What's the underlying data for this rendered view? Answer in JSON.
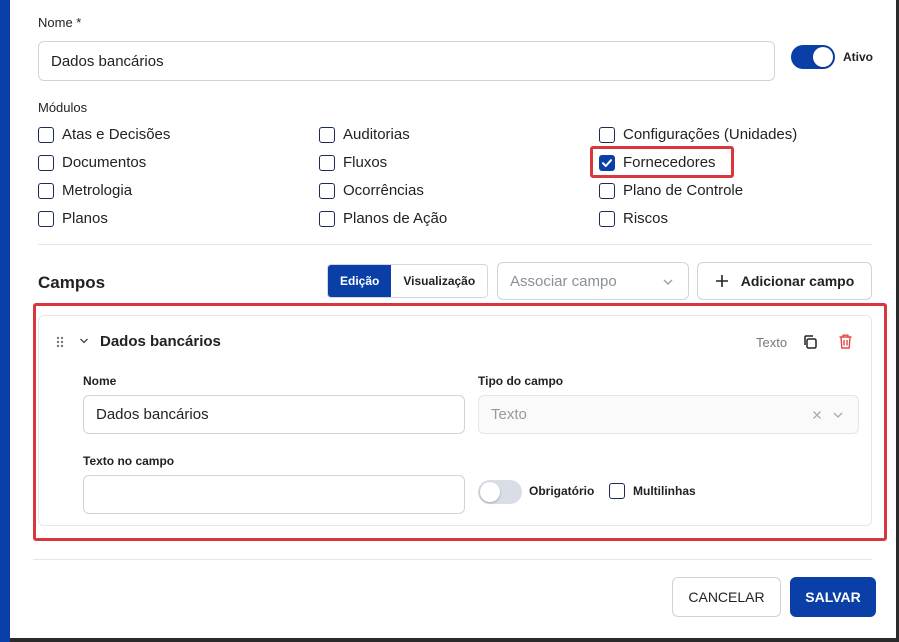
{
  "form": {
    "name_label": "Nome *",
    "name_value": "Dados bancários",
    "active_label": "Ativo",
    "active_on": true
  },
  "modules": {
    "label": "Módulos",
    "items": [
      {
        "label": "Atas e Decisões",
        "checked": false
      },
      {
        "label": "Auditorias",
        "checked": false
      },
      {
        "label": "Configurações (Unidades)",
        "checked": false
      },
      {
        "label": "Documentos",
        "checked": false
      },
      {
        "label": "Fluxos",
        "checked": false
      },
      {
        "label": "Fornecedores",
        "checked": true
      },
      {
        "label": "Metrologia",
        "checked": false
      },
      {
        "label": "Ocorrências",
        "checked": false
      },
      {
        "label": "Plano de Controle",
        "checked": false
      },
      {
        "label": "Planos",
        "checked": false
      },
      {
        "label": "Planos de Ação",
        "checked": false
      },
      {
        "label": "Riscos",
        "checked": false
      }
    ]
  },
  "fields": {
    "title": "Campos",
    "tab_edit": "Edição",
    "tab_view": "Visualização",
    "associate_placeholder": "Associar campo",
    "add_field_label": "Adicionar campo",
    "card": {
      "title": "Dados bancários",
      "type_badge": "Texto",
      "name_label": "Nome",
      "name_value": "Dados bancários",
      "type_label": "Tipo do campo",
      "type_value": "Texto",
      "placeholder_label": "Texto no campo",
      "placeholder_value": "",
      "required_label": "Obrigatório",
      "required_on": false,
      "multiline_label": "Multilinhas",
      "multiline_checked": false
    }
  },
  "footer": {
    "cancel_label": "CANCELAR",
    "save_label": "SALVAR"
  },
  "colors": {
    "primary": "#0b3fa8",
    "highlight": "#d9363e",
    "delete": "#e04848"
  },
  "icons": [
    "drag-handle-icon",
    "chevron-down-icon",
    "copy-icon",
    "trash-icon",
    "plus-icon",
    "check-icon",
    "clear-icon"
  ]
}
